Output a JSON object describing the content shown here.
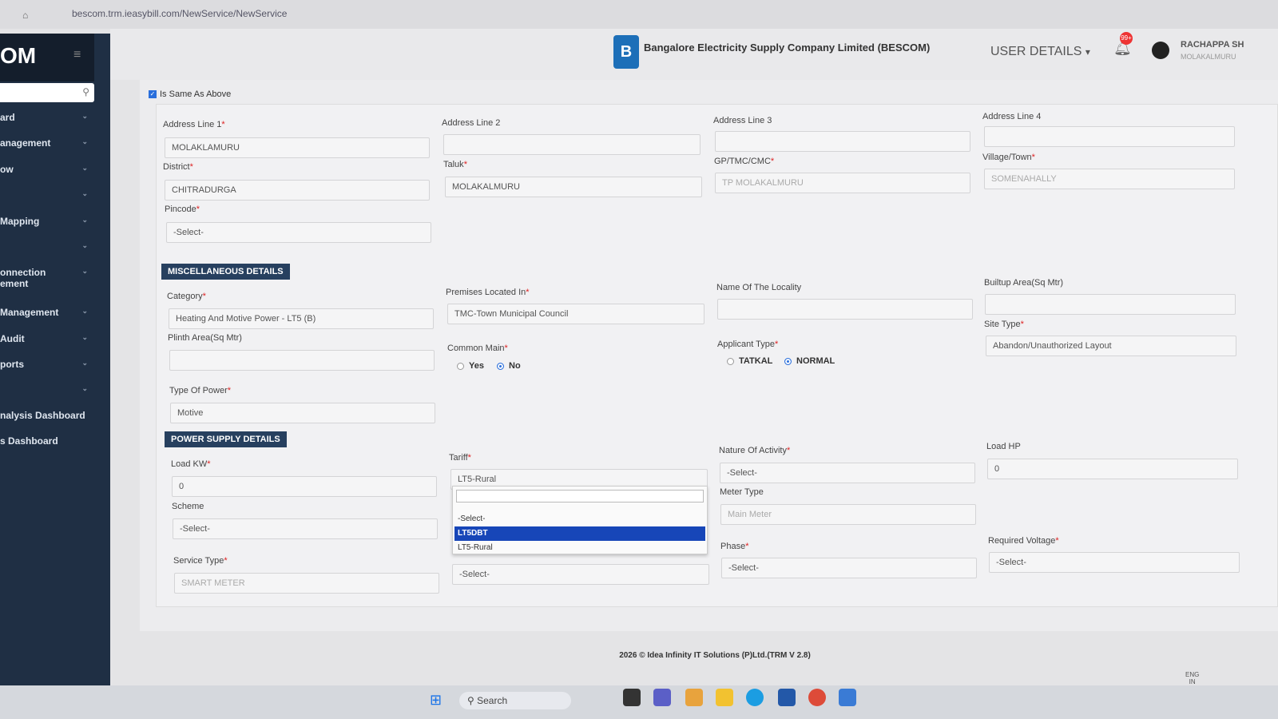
{
  "browser": {
    "url": "bescom.trm.ieasybill.com/NewService/NewService"
  },
  "sidebar": {
    "brand": "OM",
    "items": [
      "ard",
      "anagement",
      "ow",
      "",
      "Mapping",
      "",
      "onnection\nement",
      "Management",
      "Audit",
      "ports",
      "",
      "nalysis Dashboard",
      "s Dashboard"
    ]
  },
  "header": {
    "company": "Bangalore Electricity Supply Company Limited (BESCOM)",
    "user_details": "USER DETAILS",
    "user_name": "RACHAPPA SH",
    "user_location": "MOLAKALMURU",
    "badge": "99+"
  },
  "address": {
    "same_as_above": "Is Same As Above",
    "fields": [
      {
        "label": "Address Line 1",
        "req": true,
        "value": "MOLAKLAMURU"
      },
      {
        "label": "Address Line 2",
        "req": false,
        "value": ""
      },
      {
        "label": "Address Line 3",
        "req": false,
        "value": ""
      },
      {
        "label": "Address Line 4",
        "req": false,
        "value": ""
      },
      {
        "label": "District",
        "req": true,
        "value": "CHITRADURGA"
      },
      {
        "label": "Taluk",
        "req": true,
        "value": "MOLAKALMURU"
      },
      {
        "label": "GP/TMC/CMC",
        "req": true,
        "value": "TP MOLAKALMURU"
      },
      {
        "label": "Village/Town",
        "req": true,
        "value": "SOMENAHALLY"
      },
      {
        "label": "Pincode",
        "req": true,
        "value": "-Select-"
      }
    ]
  },
  "misc": {
    "title": "MISCELLANEOUS DETAILS",
    "category": {
      "label": "Category",
      "value": "Heating And Motive Power - LT5 (B)"
    },
    "premises": {
      "label": "Premises Located In",
      "value": "TMC-Town Municipal Council"
    },
    "locality": {
      "label": "Name Of The Locality",
      "value": ""
    },
    "builtup": {
      "label": "Builtup Area(Sq Mtr)",
      "value": ""
    },
    "plinth": {
      "label": "Plinth Area(Sq Mtr)",
      "value": ""
    },
    "common_main": {
      "label": "Common Main",
      "yes": "Yes",
      "no": "No",
      "selected": "No"
    },
    "applicant_type": {
      "label": "Applicant Type",
      "tatkal": "TATKAL",
      "normal": "NORMAL",
      "selected": "NORMAL"
    },
    "site_type": {
      "label": "Site Type",
      "value": "Abandon/Unauthorized Layout"
    },
    "type_of_power": {
      "label": "Type Of Power",
      "value": "Motive"
    }
  },
  "power": {
    "title": "POWER SUPPLY DETAILS",
    "load_kw": {
      "label": "Load KW",
      "value": "0"
    },
    "tariff": {
      "label": "Tariff",
      "value": "LT5-Rural",
      "options": [
        "-Select-",
        "LT5DBT",
        "LT5-Rural"
      ],
      "highlighted": "LT5DBT"
    },
    "nature": {
      "label": "Nature Of Activity",
      "value": "-Select-"
    },
    "load_hp": {
      "label": "Load HP",
      "value": "0"
    },
    "scheme": {
      "label": "Scheme",
      "value": "-Select-"
    },
    "meter_type": {
      "label": "Meter Type",
      "value": "Main Meter"
    },
    "service_type": {
      "label": "Service Type",
      "value": "SMART METER"
    },
    "below_tariff": {
      "value": "-Select-"
    },
    "phase": {
      "label": "Phase",
      "value": "-Select-"
    },
    "voltage": {
      "label": "Required Voltage",
      "value": "-Select-"
    }
  },
  "footer": "2026 © Idea Infinity IT Solutions (P)Ltd.(TRM V 2.8)",
  "taskbar": {
    "search": "Search",
    "lang": "ENG",
    "region": "IN"
  }
}
